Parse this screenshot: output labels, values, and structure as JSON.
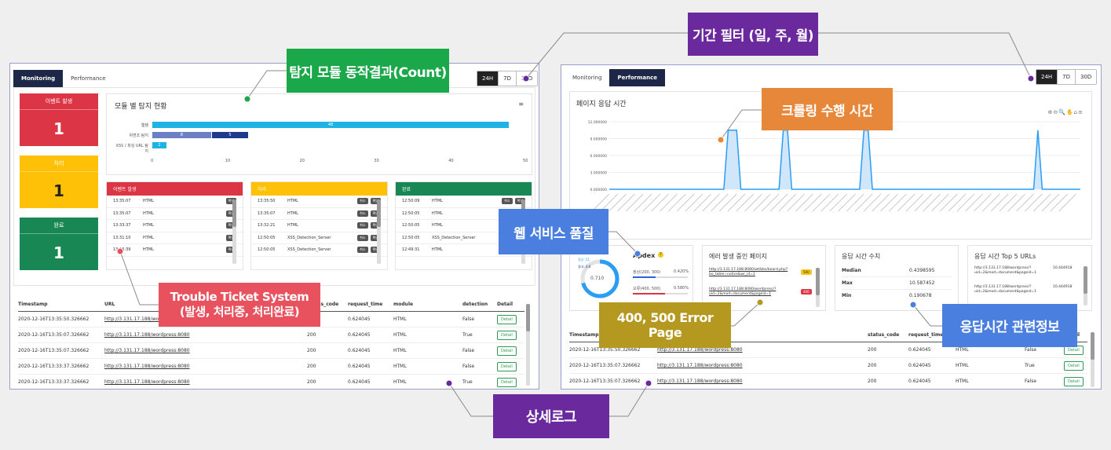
{
  "left": {
    "tabs": [
      {
        "label": "Monitoring"
      },
      {
        "label": "Performance"
      }
    ],
    "ranges": [
      {
        "label": "24H"
      },
      {
        "label": "7D"
      },
      {
        "label": "30D"
      }
    ],
    "stats": [
      {
        "label": "이벤트 발생",
        "value": "1"
      },
      {
        "label": "처리",
        "value": "1"
      },
      {
        "label": "완료",
        "value": "1"
      }
    ],
    "module_chart_title": "모듈 별 탐지 현황",
    "lists": [
      {
        "title": "이벤트 발생",
        "rows": [
          {
            "time": "13:35:07",
            "kind": "HTML",
            "btn": "확인"
          },
          {
            "time": "13:35:07",
            "kind": "HTML",
            "btn": "확인"
          },
          {
            "time": "13:33:37",
            "kind": "HTML",
            "btn": "확인"
          },
          {
            "time": "13:31:10",
            "kind": "HTML",
            "btn": "확인"
          },
          {
            "time": "13:16:39",
            "kind": "HTML",
            "btn": "확인"
          }
        ]
      },
      {
        "title": "처리",
        "rows": [
          {
            "time": "13:35:50",
            "kind": "HTML",
            "btn1": "취소",
            "btn2": "확인"
          },
          {
            "time": "13:35:07",
            "kind": "HTML",
            "btn1": "취소",
            "btn2": "확인"
          },
          {
            "time": "13:32:21",
            "kind": "HTML",
            "btn1": "취소",
            "btn2": "확인"
          },
          {
            "time": "12:50:05",
            "kind": "XSS_Detection_Server",
            "btn1": "취소",
            "btn2": "확인"
          },
          {
            "time": "12:50:05",
            "kind": "XSS_Detection_Server",
            "btn1": "취소",
            "btn2": "확인"
          }
        ]
      },
      {
        "title": "완료",
        "rows": [
          {
            "time": "12:50:09",
            "kind": "HTML",
            "btn1": "취소",
            "btn2": "확인"
          },
          {
            "time": "12:50:05",
            "kind": "HTML",
            "btn1": "취소",
            "btn2": "확인"
          },
          {
            "time": "12:50:05",
            "kind": "HTML",
            "btn1": "취소",
            "btn2": "확인"
          },
          {
            "time": "12:50:05",
            "kind": "XSS_Detection_Server",
            "btn1": "취소",
            "btn2": "확인"
          },
          {
            "time": "12:49:31",
            "kind": "HTML",
            "btn1": "취소",
            "btn2": "확인"
          }
        ]
      }
    ],
    "table": {
      "headers": [
        "Timestamp",
        "URL",
        "status_code",
        "request_time",
        "module",
        "detection",
        "Detail"
      ],
      "rows": [
        [
          "2020-12-16T13:35:50.326662",
          "http://3.131.17.188/wordpress:8080",
          "200",
          "0.624045",
          "HTML",
          "False",
          "Detail"
        ],
        [
          "2020-12-16T13:35:07.326662",
          "http://3.131.17.188/wordpress:8080",
          "200",
          "0.624045",
          "HTML",
          "True",
          "Detail"
        ],
        [
          "2020-12-16T13:35:07.326662",
          "http://3.131.17.188/wordpress:8080",
          "200",
          "0.624045",
          "HTML",
          "False",
          "Detail"
        ],
        [
          "2020-12-16T13:33:37.326662",
          "http://3.131.17.188/wordpress:8080",
          "200",
          "0.624045",
          "HTML",
          "False",
          "Detail"
        ],
        [
          "2020-12-16T13:33:37.326662",
          "http://3.131.17.188/wordpress:8080",
          "200",
          "0.624045",
          "HTML",
          "True",
          "Detail"
        ]
      ]
    }
  },
  "chart_data": [
    {
      "type": "bar",
      "orientation": "horizontal",
      "title": "모듈 별 탐지 현황",
      "categories": [
        "웹쉘",
        "위변조 탐지",
        "XSS / 피싱 URL 탐지"
      ],
      "series": [
        {
          "values": [
            48,
            8,
            2
          ],
          "color": "#1eb3e4"
        },
        {
          "values": [
            0,
            5,
            0
          ],
          "color": "#1d3a8c"
        }
      ],
      "xlim": [
        0,
        50
      ],
      "xticks": [
        0,
        10,
        20,
        30,
        40,
        50
      ]
    },
    {
      "type": "area",
      "title": "페이지 응답 시간",
      "yticks": [
        "12.000000",
        "9.000000",
        "6.000000",
        "3.000000",
        "0.000000"
      ],
      "ylim": [
        0,
        12
      ],
      "values": [
        0,
        0,
        0,
        0,
        0,
        0,
        0,
        0,
        0,
        0,
        0,
        0,
        0,
        0,
        0,
        0,
        0,
        0,
        0,
        0,
        0,
        0,
        0,
        0,
        0,
        0,
        0,
        0,
        10.5,
        10.5,
        10.5,
        0,
        0,
        0,
        0,
        0,
        0,
        0,
        0,
        0,
        0,
        10.5,
        10.5,
        0,
        0,
        0,
        0,
        0,
        0,
        0,
        0,
        0,
        0,
        0,
        0,
        0,
        0,
        0,
        0,
        0,
        10.5,
        10.5,
        0,
        0,
        0,
        0,
        0,
        0,
        0,
        0,
        0,
        0,
        0,
        0,
        0,
        0,
        0,
        0,
        0,
        0,
        0,
        0,
        0,
        0,
        0,
        0,
        0,
        0,
        0,
        0,
        0,
        0,
        0,
        0,
        0,
        0,
        0,
        0,
        0,
        0,
        0,
        10.5,
        0,
        0,
        0,
        0,
        0,
        0,
        0,
        0,
        0,
        0
      ],
      "color": "#2a9df4"
    }
  ],
  "right": {
    "tabs": [
      {
        "label": "Monitoring"
      },
      {
        "label": "Performance"
      }
    ],
    "ranges": [
      {
        "label": "24H"
      },
      {
        "label": "7D"
      },
      {
        "label": "30D"
      }
    ],
    "chart_title": "페이지 응답 시간",
    "apdex": {
      "title": "Apdex",
      "score": "0.710",
      "legend1": "정상: 21",
      "legend2": "경고: 0.6",
      "row1_label": "정상(200, 300)",
      "row1_value": "0.420%",
      "row2_label": "오류(400, 500)",
      "row2_value": "0.580%"
    },
    "errors": {
      "title": "에러 발생 중인 페이지",
      "items": [
        {
          "url": "http://3.131.17.188:8080/wt/bbs/board.php?bo_table=notice&wr_id=1",
          "code": "500"
        },
        {
          "url": "http://3.131.17.188:8080/wordpress/?uid=2&mod=document&pageid=1",
          "code": "400"
        }
      ]
    },
    "resp": {
      "title": "응답 시간 수치",
      "rows": [
        {
          "label": "Median",
          "value": "0.4398595"
        },
        {
          "label": "Max",
          "value": "10.587452"
        },
        {
          "label": "Min",
          "value": "0.190678"
        }
      ]
    },
    "top5": {
      "title": "응답 시간 Top 5 URLs",
      "items": [
        {
          "url": "http://3.131.17.188/wordpress/?uid=2&mod=document&pageid=1",
          "value": "10.444918"
        },
        {
          "url": "http://3.131.17.188/wordpress/?uid=2&mod=document&pageid=1",
          "value": "10.444918"
        }
      ]
    },
    "table": {
      "headers": [
        "Timestamp",
        "URL",
        "status_code",
        "request_time",
        "module",
        "detection",
        "Detail"
      ],
      "rows": [
        [
          "2020-12-16T13:35:50.326662",
          "http://3.131.17.188/wordpress:8080",
          "200",
          "0.624045",
          "HTML",
          "False",
          "Detail"
        ],
        [
          "2020-12-16T13:35:07.326662",
          "http://3.131.17.188/wordpress:8080",
          "200",
          "0.624045",
          "HTML",
          "True",
          "Detail"
        ],
        [
          "2020-12-16T13:35:07.326662",
          "http://3.131.17.188/wordpress:8080",
          "200",
          "0.624045",
          "HTML",
          "False",
          "Detail"
        ]
      ]
    }
  },
  "callouts": {
    "count": "탐지 모듈 동작결과(Count)",
    "period": "기간 필터 (일, 주, 월)",
    "crawl": "크롤링 수행 시간",
    "web_quality": "웹 서비스 품질",
    "tts_line1": "Trouble Ticket System",
    "tts_line2": "(발생, 처리중, 처리완료)",
    "error_page": "400, 500 Error Page",
    "resp_info": "응답시간 관련정보",
    "detail_log": "상세로그"
  },
  "colors": {
    "red": "#dc3545",
    "yellow": "#ffc107",
    "green": "#198754",
    "navy": "#1d2747",
    "purple": "#6a2a9e",
    "orange": "#e6873a",
    "callout_green": "#1aa84a",
    "callout_pink": "#e8525e",
    "callout_gold": "#b5981f",
    "callout_blue": "#4a7fe0"
  }
}
